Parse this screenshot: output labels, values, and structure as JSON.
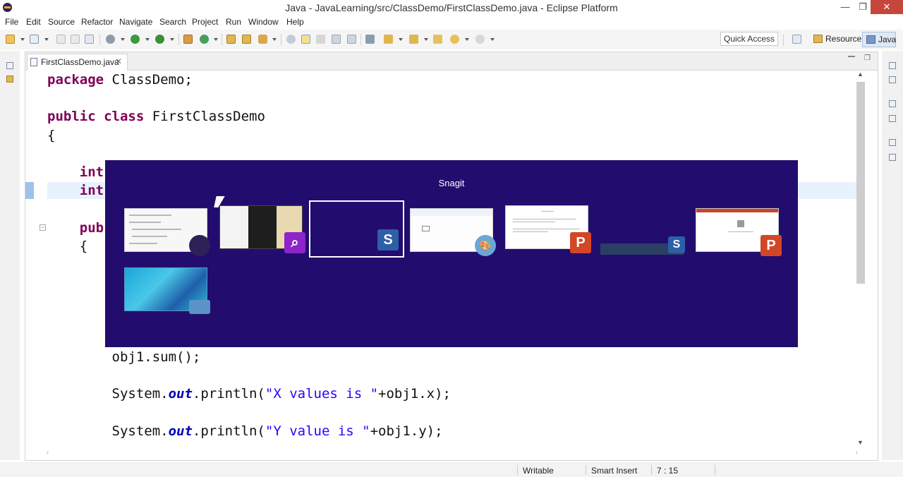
{
  "window": {
    "title": "Java - JavaLearning/src/ClassDemo/FirstClassDemo.java - Eclipse Platform",
    "controls": {
      "minimize": "—",
      "maximize": "❐",
      "close": "✕"
    }
  },
  "menu": {
    "items": [
      "File",
      "Edit",
      "Source",
      "Refactor",
      "Navigate",
      "Search",
      "Project",
      "Run",
      "Window",
      "Help"
    ]
  },
  "toolbar": {
    "quick_access_label": "Quick Access",
    "perspectives": [
      {
        "label": "Resource",
        "icon": "resource-perspective-icon"
      },
      {
        "label": "Java",
        "icon": "java-perspective-icon",
        "active": true
      }
    ]
  },
  "editor": {
    "tab": {
      "label": "FirstClassDemo.java",
      "close": "✕",
      "icon": "java-file-icon"
    },
    "code_lines": [
      {
        "tokens": [
          {
            "t": "package",
            "c": "kw"
          },
          {
            "t": " ClassDemo;",
            "c": "txt"
          }
        ]
      },
      {
        "tokens": []
      },
      {
        "tokens": [
          {
            "t": "public",
            "c": "kw"
          },
          {
            "t": " ",
            "c": "txt"
          },
          {
            "t": "class",
            "c": "kw"
          },
          {
            "t": " FirstClassDemo",
            "c": "txt"
          }
        ]
      },
      {
        "tokens": [
          {
            "t": "{",
            "c": "txt"
          }
        ]
      },
      {
        "tokens": []
      },
      {
        "tokens": [
          {
            "t": "    int",
            "c": "kw"
          }
        ]
      },
      {
        "tokens": [
          {
            "t": "    int",
            "c": "kw"
          }
        ]
      },
      {
        "tokens": []
      },
      {
        "tokens": [
          {
            "t": "    pub",
            "c": "kw"
          }
        ]
      },
      {
        "tokens": [
          {
            "t": "    {",
            "c": "txt"
          }
        ]
      },
      {
        "tokens": []
      },
      {
        "tokens": []
      },
      {
        "tokens": []
      },
      {
        "tokens": []
      },
      {
        "tokens": []
      },
      {
        "tokens": [
          {
            "t": "        obj1.sum();",
            "c": "txt"
          }
        ]
      },
      {
        "tokens": []
      },
      {
        "tokens": [
          {
            "t": "        System.",
            "c": "txt"
          },
          {
            "t": "out",
            "c": "fld"
          },
          {
            "t": ".println(",
            "c": "txt"
          },
          {
            "t": "\"X values is \"",
            "c": "str"
          },
          {
            "t": "+obj1.x);",
            "c": "txt"
          }
        ]
      },
      {
        "tokens": []
      },
      {
        "tokens": [
          {
            "t": "        System.",
            "c": "txt"
          },
          {
            "t": "out",
            "c": "fld"
          },
          {
            "t": ".println(",
            "c": "txt"
          },
          {
            "t": "\"Y value is \"",
            "c": "str"
          },
          {
            "t": "+obj1.y);",
            "c": "txt"
          }
        ]
      }
    ]
  },
  "status": {
    "writable": "Writable",
    "insert_mode": "Smart Insert",
    "position": "7 : 15"
  },
  "switcher": {
    "title": "Snagit",
    "thumbnails": [
      {
        "name": "eclipse-window-thumbnail",
        "badge": "",
        "badge_color": "#3a2f5c"
      },
      {
        "name": "search-app-window-thumbnail",
        "badge": "⌕",
        "badge_color": "#8e24c9"
      },
      {
        "name": "snagit-blank-window-thumbnail",
        "badge": "S",
        "badge_color": "#2d5fa6",
        "selected": true
      },
      {
        "name": "paint-window-thumbnail",
        "badge": "🎨",
        "badge_color": "#6aa7d8"
      },
      {
        "name": "document-window-thumbnail",
        "badge": "P",
        "badge_color": "#d24726"
      },
      {
        "name": "snagit-capture-bar-thumbnail",
        "badge": "S",
        "badge_color": "#2d5fa6"
      },
      {
        "name": "powerpoint-window-thumbnail",
        "badge": "P",
        "badge_color": "#d24726"
      },
      {
        "name": "desktop-thumbnail",
        "badge": "",
        "badge_color": "#5b93c8"
      }
    ]
  }
}
